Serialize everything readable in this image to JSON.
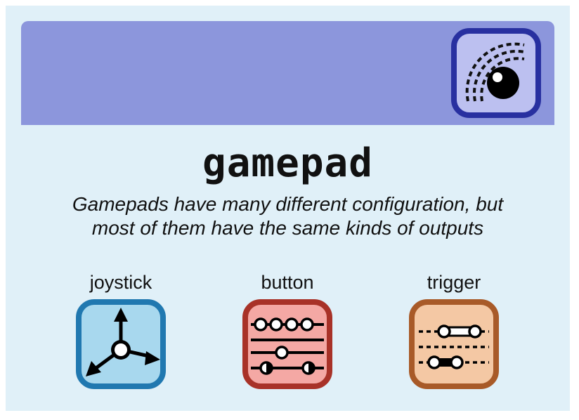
{
  "title": "gamepad",
  "subtitle_line1": "Gamepads have many different configuration, but",
  "subtitle_line2": "most of them have the same kinds of outputs",
  "banner_icon": "camera-lens-icon",
  "outputs": [
    {
      "label": "joystick",
      "icon": "joystick-icon",
      "color": "#2078b0"
    },
    {
      "label": "button",
      "icon": "button-icon",
      "color": "#a83228"
    },
    {
      "label": "trigger",
      "icon": "trigger-icon",
      "color": "#a85a28"
    }
  ],
  "colors": {
    "card_background": "#e0f0f8",
    "banner": "#8c96dc",
    "banner_icon_border": "#2830a0",
    "banner_icon_fill": "#bcc0f0"
  }
}
